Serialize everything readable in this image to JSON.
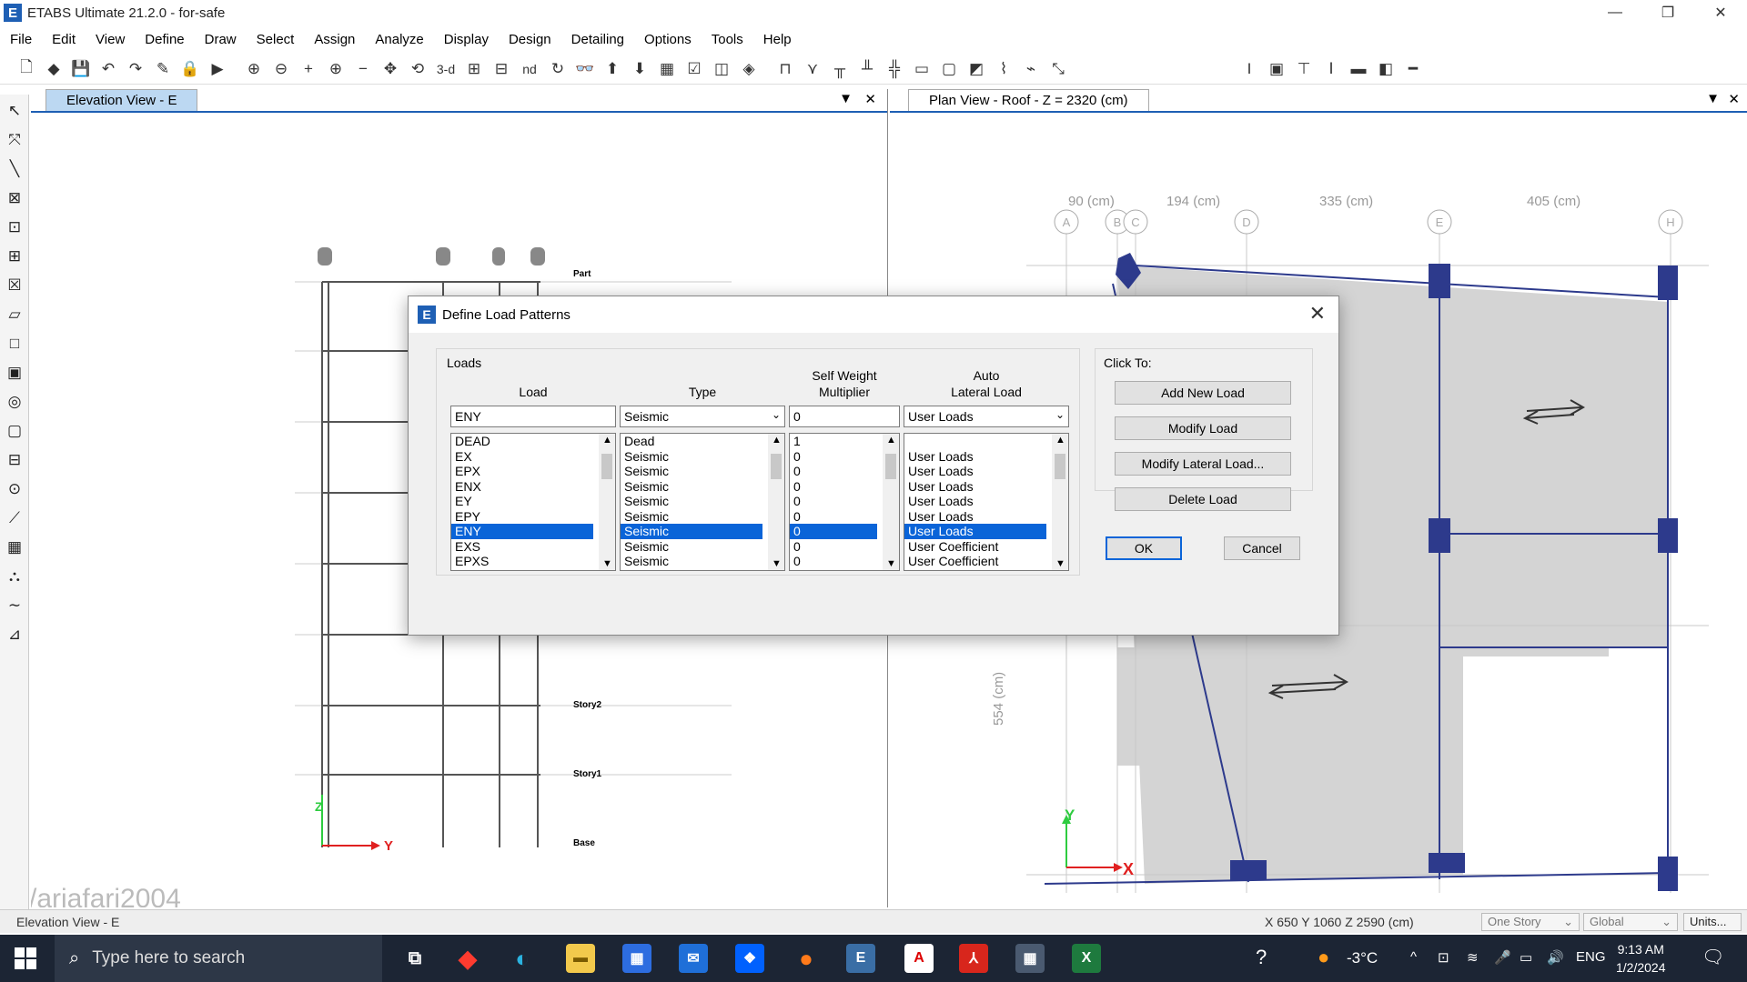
{
  "app": {
    "title": "ETABS Ultimate 21.2.0 - for-safe",
    "icon": "E"
  },
  "window_controls": {
    "minimize": "—",
    "restore": "❐",
    "close": "✕"
  },
  "menu": [
    "File",
    "Edit",
    "View",
    "Define",
    "Draw",
    "Select",
    "Assign",
    "Analyze",
    "Display",
    "Design",
    "Detailing",
    "Options",
    "Tools",
    "Help"
  ],
  "toolbar": {
    "three_d_label": "3-d",
    "nd_label": "nd"
  },
  "views": {
    "elevation": {
      "tab_label": "Elevation View - E",
      "story_labels": [
        "Part",
        "Story2",
        "Story1",
        "Base"
      ],
      "axis_z": "Z",
      "axis_y": "Y"
    },
    "plan": {
      "tab_label": "Plan View - Roof - Z = 2320 (cm)",
      "dims": [
        "90 (cm)",
        "194 (cm)",
        "335 (cm)",
        "405 (cm)",
        "554 (cm)"
      ],
      "grid_bubbles": [
        "A",
        "B",
        "C",
        "D",
        "E",
        "H"
      ],
      "axis_x": "X",
      "axis_y": "Y"
    }
  },
  "dialog": {
    "title": "Define Load Patterns",
    "loads_group_label": "Loads",
    "click_to_label": "Click To:",
    "columns": {
      "load": "Load",
      "type": "Type",
      "self_weight": [
        "Self Weight",
        "Multiplier"
      ],
      "auto_lateral": [
        "Auto",
        "Lateral Load"
      ]
    },
    "current": {
      "load": "ENY",
      "type": "Seismic",
      "multiplier": "0",
      "auto_lateral": "User Loads"
    },
    "rows": [
      {
        "load": "DEAD",
        "type": "Dead",
        "multiplier": "1",
        "auto_lateral": ""
      },
      {
        "load": "EX",
        "type": "Seismic",
        "multiplier": "0",
        "auto_lateral": "User Loads"
      },
      {
        "load": "EPX",
        "type": "Seismic",
        "multiplier": "0",
        "auto_lateral": "User Loads"
      },
      {
        "load": "ENX",
        "type": "Seismic",
        "multiplier": "0",
        "auto_lateral": "User Loads"
      },
      {
        "load": "EY",
        "type": "Seismic",
        "multiplier": "0",
        "auto_lateral": "User Loads"
      },
      {
        "load": "EPY",
        "type": "Seismic",
        "multiplier": "0",
        "auto_lateral": "User Loads"
      },
      {
        "load": "ENY",
        "type": "Seismic",
        "multiplier": "0",
        "auto_lateral": "User Loads"
      },
      {
        "load": "EXS",
        "type": "Seismic",
        "multiplier": "0",
        "auto_lateral": "User Coefficient"
      },
      {
        "load": "EPXS",
        "type": "Seismic",
        "multiplier": "0",
        "auto_lateral": "User Coefficient"
      }
    ],
    "selected_index": 6,
    "buttons": {
      "add_new": "Add New Load",
      "modify": "Modify Load",
      "modify_lateral": "Modify Lateral Load...",
      "delete": "Delete Load",
      "ok": "OK",
      "cancel": "Cancel"
    }
  },
  "statusbar": {
    "left": "Elevation View - E",
    "coords": "X 650  Y 1060  Z 2590 (cm)",
    "story_mode": "One Story",
    "coord_system": "Global",
    "units_button": "Units..."
  },
  "watermark": "/ariafari2004",
  "taskbar": {
    "search_placeholder": "Type here to search",
    "temperature": "-3°C",
    "language": "ENG",
    "time": "9:13 AM",
    "date": "1/2/2024"
  },
  "colors": {
    "accent": "#1e5fb4",
    "selection": "#0a64d8",
    "taskbar": "#1c2534",
    "member": "#2d3a8c"
  }
}
